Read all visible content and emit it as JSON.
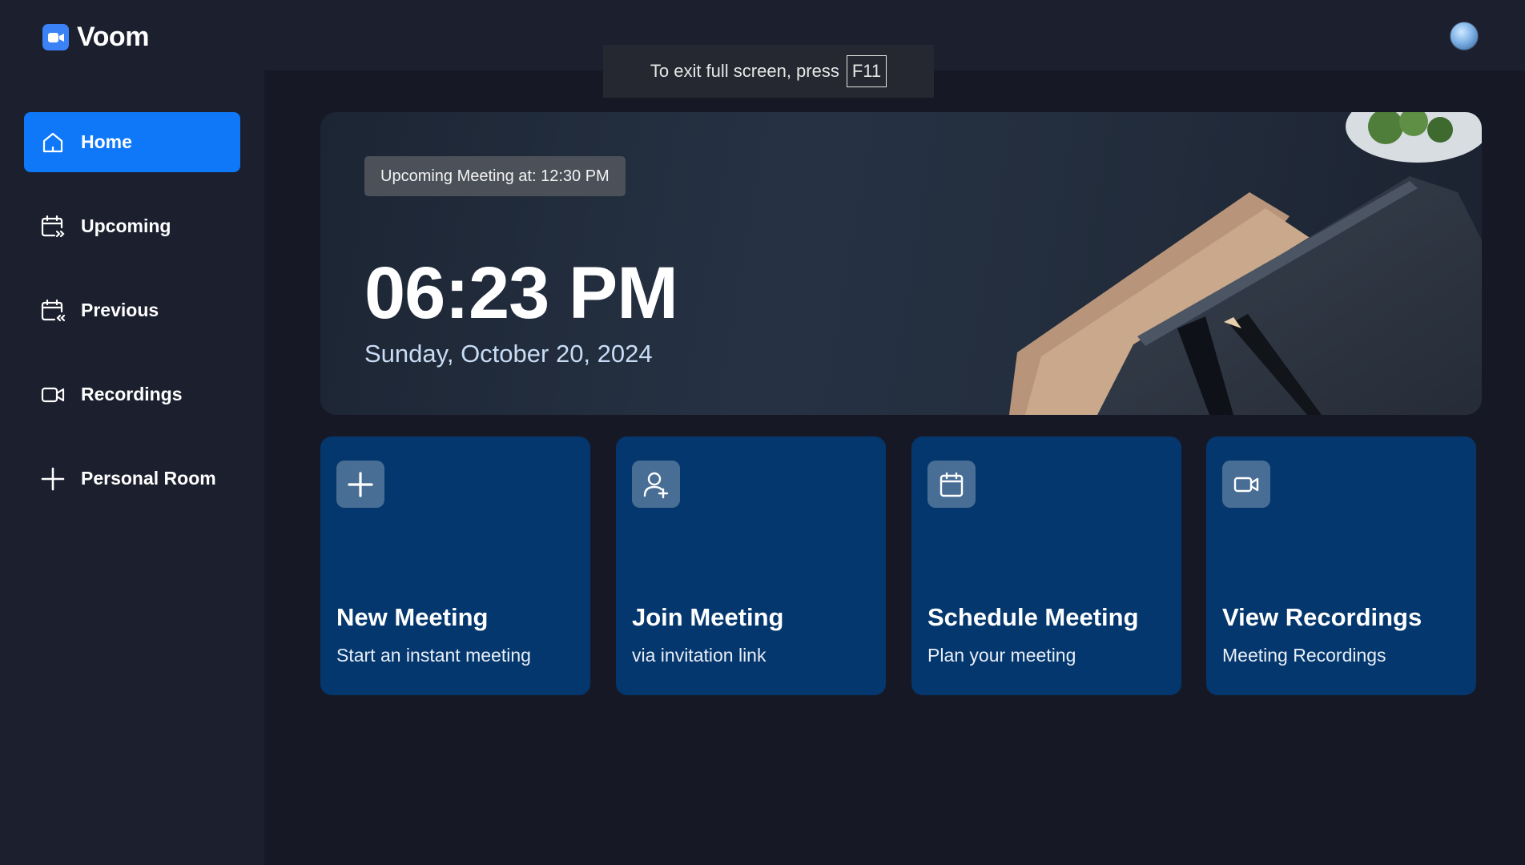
{
  "app": {
    "name": "Voom"
  },
  "fullscreen_toast": {
    "text": "To exit full screen, press",
    "key": "F11"
  },
  "sidebar": {
    "items": [
      {
        "label": "Home",
        "icon": "home-icon",
        "active": true
      },
      {
        "label": "Upcoming",
        "icon": "calendar-forward-icon",
        "active": false
      },
      {
        "label": "Previous",
        "icon": "calendar-back-icon",
        "active": false
      },
      {
        "label": "Recordings",
        "icon": "video-icon",
        "active": false
      },
      {
        "label": "Personal Room",
        "icon": "plus-icon",
        "active": false
      }
    ]
  },
  "hero": {
    "badge": "Upcoming Meeting at: 12:30 PM",
    "time": "06:23 PM",
    "date": "Sunday, October 20, 2024"
  },
  "cards": [
    {
      "title": "New Meeting",
      "subtitle": "Start an instant meeting",
      "icon": "plus-icon"
    },
    {
      "title": "Join Meeting",
      "subtitle": "via invitation link",
      "icon": "user-plus-icon"
    },
    {
      "title": "Schedule Meeting",
      "subtitle": "Plan your meeting",
      "icon": "calendar-icon"
    },
    {
      "title": "View Recordings",
      "subtitle": "Meeting Recordings",
      "icon": "video-icon"
    }
  ],
  "colors": {
    "accent": "#0e78f9",
    "card_bg": "#04376d",
    "sidebar_bg": "#1c1f2e",
    "main_bg": "#161925"
  }
}
